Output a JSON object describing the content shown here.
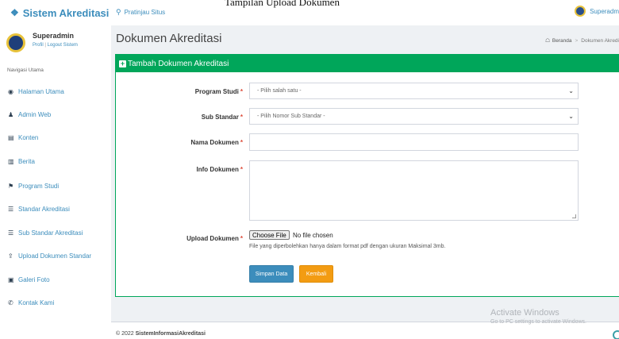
{
  "caption": "Tampilan Upload Dokumen",
  "brand": {
    "icon": "home-icon",
    "title": "Sistem Akreditasi"
  },
  "topbar": {
    "preview_icon": "search-icon",
    "preview_label": "Pratinjau Situs",
    "user_label": "Superadm"
  },
  "sidebar": {
    "profile": {
      "name": "Superadmin",
      "profile_link": "Profil",
      "sep": "|",
      "logout_link": "Logout Sistem"
    },
    "nav_heading": "Navigasi Utama",
    "items": [
      {
        "icon": "dashboard-icon",
        "glyph": "◉",
        "label": "Halaman Utama"
      },
      {
        "icon": "user-icon",
        "glyph": "♟",
        "label": "Admin Web"
      },
      {
        "icon": "content-icon",
        "glyph": "▤",
        "label": "Konten"
      },
      {
        "icon": "news-icon",
        "glyph": "▥",
        "label": "Berita"
      },
      {
        "icon": "flag-icon",
        "glyph": "⚑",
        "label": "Program Studi"
      },
      {
        "icon": "list-icon",
        "glyph": "☰",
        "label": "Standar Akreditasi"
      },
      {
        "icon": "list-icon",
        "glyph": "☰",
        "label": "Sub Standar Akreditasi"
      },
      {
        "icon": "upload-icon",
        "glyph": "⇪",
        "label": "Upload Dokumen Standar"
      },
      {
        "icon": "image-icon",
        "glyph": "▣",
        "label": "Galeri Foto"
      },
      {
        "icon": "phone-icon",
        "glyph": "✆",
        "label": "Kontak Kami"
      }
    ]
  },
  "page": {
    "title": "Dokumen Akreditasi"
  },
  "breadcrumb": {
    "home_icon": "home-icon",
    "home": "Beranda",
    "sep": ">",
    "current": "Dokumen Akredi"
  },
  "form": {
    "header": "Tambah Dokumen Akreditasi",
    "required_mark": "*",
    "program_label": "Program Studi",
    "program_value": "- Pilih salah satu -",
    "sub_label": "Sub Standar",
    "sub_value": "- Pilih Nomor Sub Standar -",
    "nama_label": "Nama Dokumen",
    "nama_value": "",
    "info_label": "Info Dokumen",
    "info_value": "",
    "upload_label": "Upload Dokumen",
    "file_button": "Choose File",
    "file_status": "No file chosen",
    "file_help": "File yang diperbolehkan hanya dalam format pdf dengan ukuran Maksimal 3mb.",
    "save_label": "Simpan Data",
    "back_label": "Kembali"
  },
  "footer": {
    "prefix": "© 2022 ",
    "site": "SistemInformasiAkreditasi"
  },
  "watermark": {
    "line1": "Activate Windows",
    "line2": "Go to PC settings to activate Windows."
  },
  "colors": {
    "accent": "#3c8dbc",
    "success": "#00a65a",
    "warning": "#f39c12",
    "danger": "#dd4b39"
  }
}
